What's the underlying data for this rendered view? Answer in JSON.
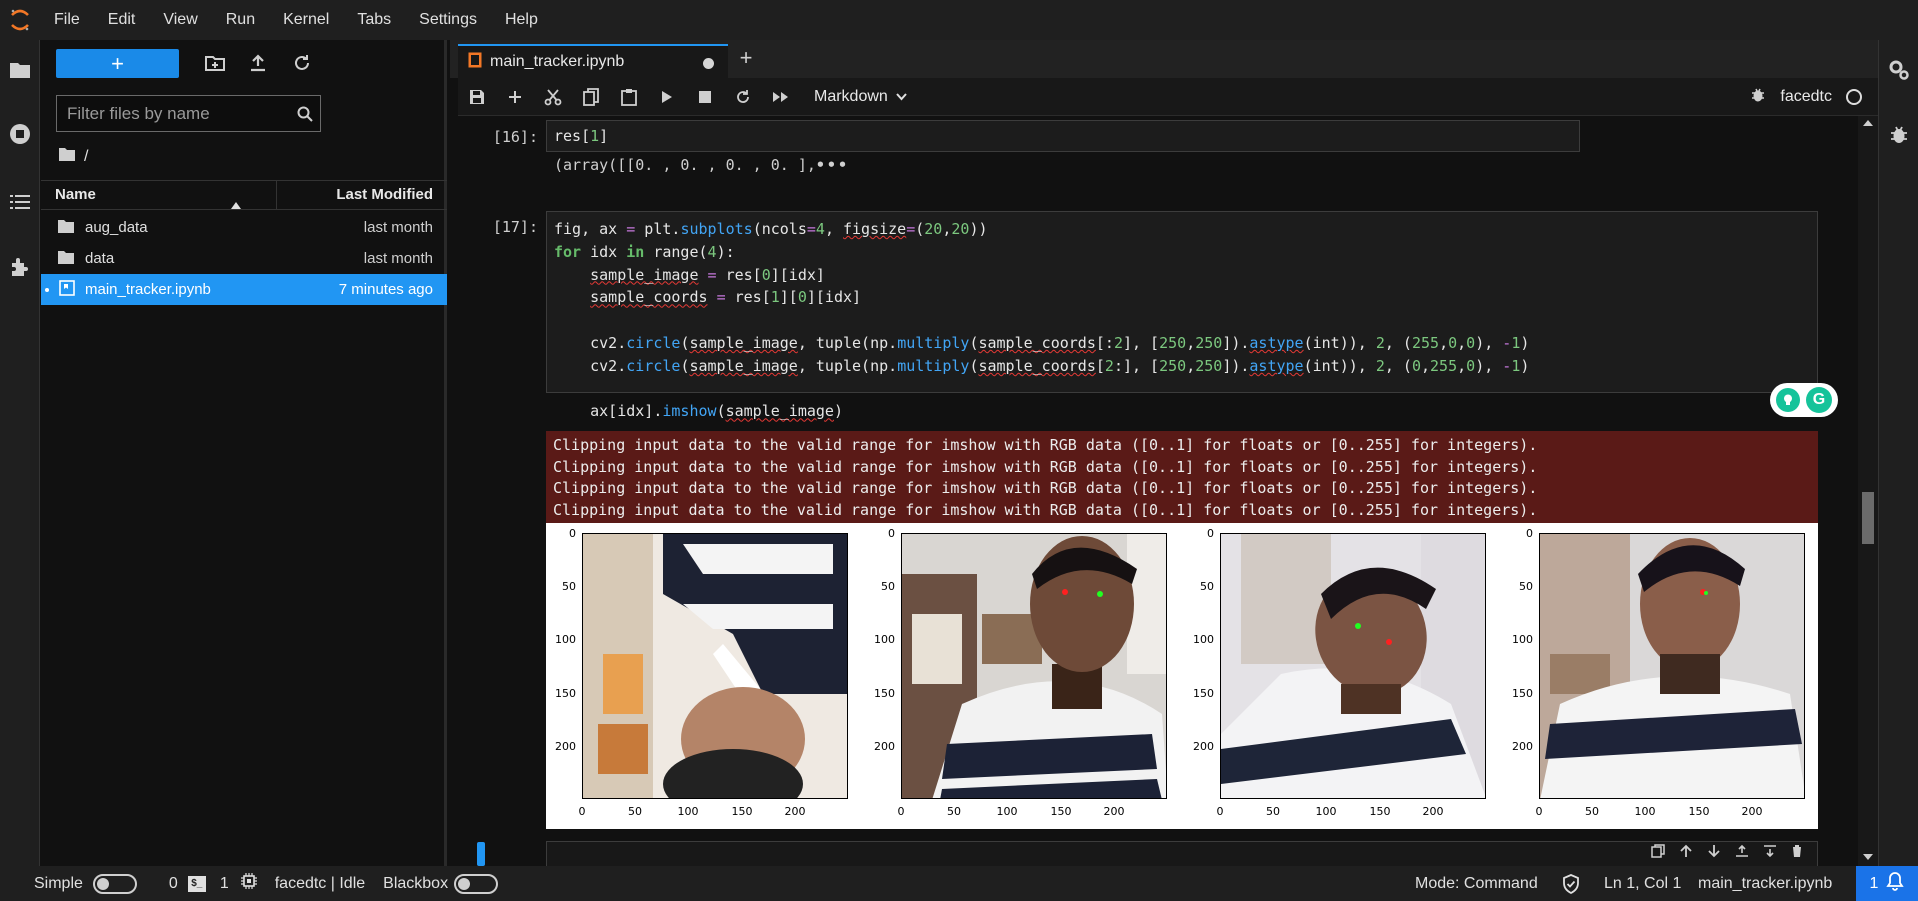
{
  "menubar": {
    "items": [
      "File",
      "Edit",
      "View",
      "Run",
      "Kernel",
      "Tabs",
      "Settings",
      "Help"
    ]
  },
  "filebrowser": {
    "new_label": "+",
    "filter_placeholder": "Filter files by name",
    "breadcrumb": "/",
    "columns": {
      "name": "Name",
      "modified": "Last Modified"
    },
    "files": [
      {
        "name": "aug_data",
        "type": "folder",
        "modified": "last month"
      },
      {
        "name": "data",
        "type": "folder",
        "modified": "last month"
      },
      {
        "name": "main_tracker.ipynb",
        "type": "notebook",
        "modified": "7 minutes ago",
        "selected": true
      }
    ]
  },
  "tabs": {
    "active": "main_tracker.ipynb"
  },
  "toolbar": {
    "cell_type": "Markdown",
    "kernel_name": "facedtc"
  },
  "cells": {
    "c16": {
      "prompt": "[16]:",
      "code": "res[1]",
      "output": "(array([[0. , 0. , 0. , 0. ],"
    },
    "c17": {
      "prompt": "[17]:",
      "stderr": [
        "Clipping input data to the valid range for imshow with RGB data ([0..1] for floats or [0..255] for integers).",
        "Clipping input data to the valid range for imshow with RGB data ([0..1] for floats or [0..255] for integers).",
        "Clipping input data to the valid range for imshow with RGB data ([0..1] for floats or [0..255] for integers).",
        "Clipping input data to the valid range for imshow with RGB data ([0..1] for floats or [0..255] for integers)."
      ],
      "yticks": [
        "0",
        "50",
        "100",
        "150",
        "200"
      ],
      "xticks": [
        "0",
        "50",
        "100",
        "150",
        "200"
      ]
    }
  },
  "statusbar": {
    "mode_label": "Simple",
    "terminals_count": "0",
    "kernels_count": "1",
    "kernel_status": "facedtc | Idle",
    "blackbox_label": "Blackbox",
    "command_mode": "Mode: Command",
    "cursor": "Ln 1, Col 1",
    "filename": "main_tracker.ipynb",
    "notifications": "1"
  },
  "colors": {
    "accent": "#2196f3",
    "stderr_bg": "#5a1a17",
    "launcher": "#1a8ae8"
  }
}
